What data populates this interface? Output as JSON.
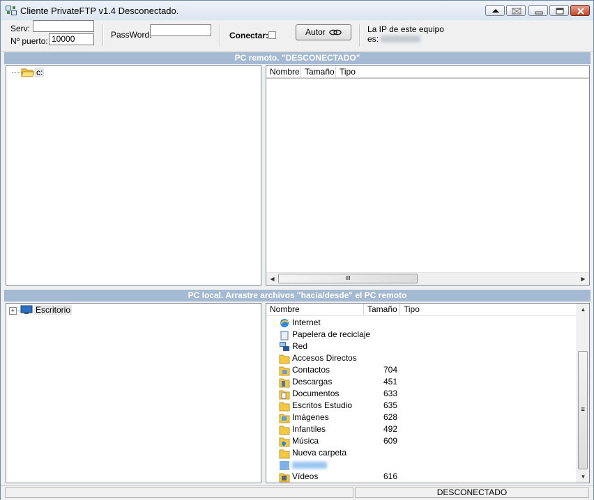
{
  "window": {
    "title": "Cliente PrivateFTP v1.4 Desconectado."
  },
  "toolbar": {
    "server_label": "Serv:",
    "server_value": "",
    "port_label": "Nº puerto:",
    "port_value": "10000",
    "password_label": "PassWord:",
    "password_value": "",
    "connect_label": "Conectar:",
    "connect_checked": false,
    "autor_label": "Autor",
    "ip_label_line1": "La IP de este equipo",
    "ip_label_line2": "es:"
  },
  "remote": {
    "header": "PC remoto. \"DESCONECTADO\"",
    "tree_root": "c:",
    "columns": [
      "Nombre",
      "Tamaño",
      "Tipo"
    ],
    "scroll_grip": "III"
  },
  "local": {
    "header": "PC local.   Arrastre archivos \"hacia/desde\" el PC remoto",
    "tree_root": "Escritorio",
    "tree_expander": "+",
    "columns": [
      "Nombre",
      "Tamaño",
      "Tipo"
    ],
    "scroll_grip": "≡",
    "files": [
      {
        "name": "Internet",
        "size": "",
        "icon": "internet-explorer-icon"
      },
      {
        "name": "Papelera de reciclaje",
        "size": "",
        "icon": "recycle-bin-icon"
      },
      {
        "name": "Red",
        "size": "",
        "icon": "network-icon"
      },
      {
        "name": "Accesos Directos",
        "size": "",
        "icon": "folder-icon"
      },
      {
        "name": "Contactos",
        "size": "704",
        "icon": "contacts-folder-icon"
      },
      {
        "name": "Descargas",
        "size": "451",
        "icon": "downloads-folder-icon"
      },
      {
        "name": "Documentos",
        "size": "633",
        "icon": "documents-folder-icon"
      },
      {
        "name": "Escritos Estudio",
        "size": "635",
        "icon": "folder-icon"
      },
      {
        "name": "Imágenes",
        "size": "628",
        "icon": "pictures-folder-icon"
      },
      {
        "name": "Infantiles",
        "size": "492",
        "icon": "folder-icon"
      },
      {
        "name": "Música",
        "size": "609",
        "icon": "music-folder-icon"
      },
      {
        "name": "Nueva carpeta",
        "size": "",
        "icon": "folder-icon"
      },
      {
        "name": "",
        "size": "",
        "icon": "user-folder-icon"
      },
      {
        "name": "Vídeos",
        "size": "616",
        "icon": "videos-folder-icon"
      }
    ]
  },
  "status": {
    "left": "",
    "right": "DESCONECTADO"
  },
  "colors": {
    "section_bar": "#a4bad2",
    "folder": "#f5c842",
    "close_button": "#c0452a"
  }
}
